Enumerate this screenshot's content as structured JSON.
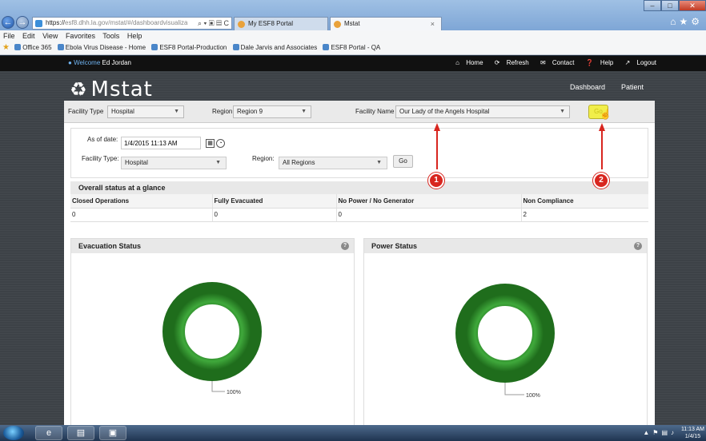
{
  "browser": {
    "url_https": "https://",
    "url_rest": "esf8.dhh.la.gov/mstat/#/dashboardvisualiza",
    "url_icons": "⌕ ▾ ▣ ▤ C",
    "tabs": [
      {
        "label": "My ESF8 Portal"
      },
      {
        "label": "Mstat"
      }
    ],
    "tab_close": "×",
    "menu": [
      "File",
      "Edit",
      "View",
      "Favorites",
      "Tools",
      "Help"
    ],
    "favorites": [
      "Office 365",
      "Ebola Virus Disease - Home",
      "ESF8 Portal-Production",
      "Dale Jarvis and Associates",
      "ESF8 Portal - QA"
    ]
  },
  "site": {
    "welcome_prefix": "Welcome",
    "user_name": "Ed Jordan",
    "topnav": [
      "Home",
      "Refresh",
      "Contact",
      "Help",
      "Logout"
    ],
    "logo": "Mstat",
    "subnav": [
      "Dashboard",
      "Patient"
    ]
  },
  "filters": {
    "facility_type_label": "Facility Type",
    "facility_type_value": "Hospital",
    "region_label": "Region",
    "region_value": "Region 9",
    "facility_name_label": "Facility Name",
    "facility_name_value": "Our Lady of the Angels Hospital",
    "go_label": "Go"
  },
  "form": {
    "as_of_label": "As of date:",
    "as_of_value": "1/4/2015 11:13 AM",
    "facility_type_label": "Facility Type:",
    "facility_type_value": "Hospital",
    "region_label": "Region:",
    "region_value": "All Regions",
    "go_label": "Go"
  },
  "status": {
    "heading": "Overall status at a glance",
    "columns": [
      "Closed Operations",
      "Fully Evacuated",
      "No Power / No Generator",
      "Non Compliance"
    ],
    "values": [
      "0",
      "0",
      "0",
      "2"
    ]
  },
  "charts": {
    "evacuation": {
      "title": "Evacuation Status",
      "label": "100%",
      "fraction": 1.0,
      "color": "#2e8f2b"
    },
    "power": {
      "title": "Power Status",
      "label": "100%",
      "fraction": 1.0,
      "color": "#2e8f2b"
    }
  },
  "annotations": [
    "1",
    "2"
  ],
  "taskbar": {
    "time": "11:13 AM",
    "date": "1/4/15"
  },
  "colors": {
    "annotation_red": "#d8261f",
    "go_yellow": "#f1ee4a",
    "link_blue": "#6fb2ef"
  }
}
